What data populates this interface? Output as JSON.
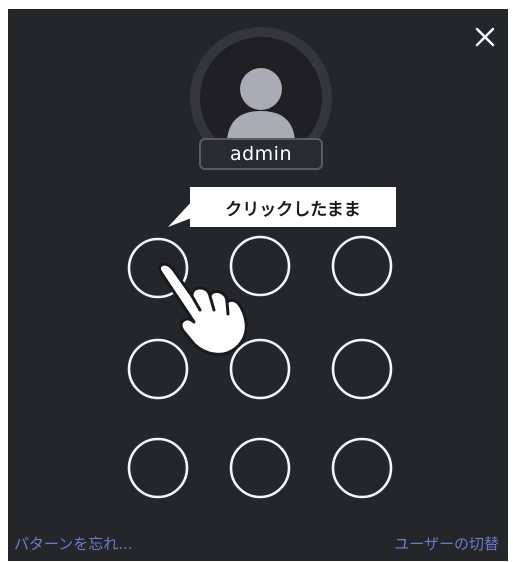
{
  "dialog": {
    "username": "admin",
    "callout": "クリックしたまま",
    "forgot_pattern_link": "パターンを忘れ...",
    "switch_user_link": "ユーザーの切替"
  },
  "icons": {
    "close": "close-icon",
    "avatar": "user-avatar-icon",
    "hand": "pointing-hand-icon"
  },
  "pattern_grid": {
    "rows": 3,
    "cols": 3
  },
  "colors": {
    "panel_bg": "#25262a",
    "link": "#6e79c9",
    "callout_bg": "#ffffff"
  }
}
